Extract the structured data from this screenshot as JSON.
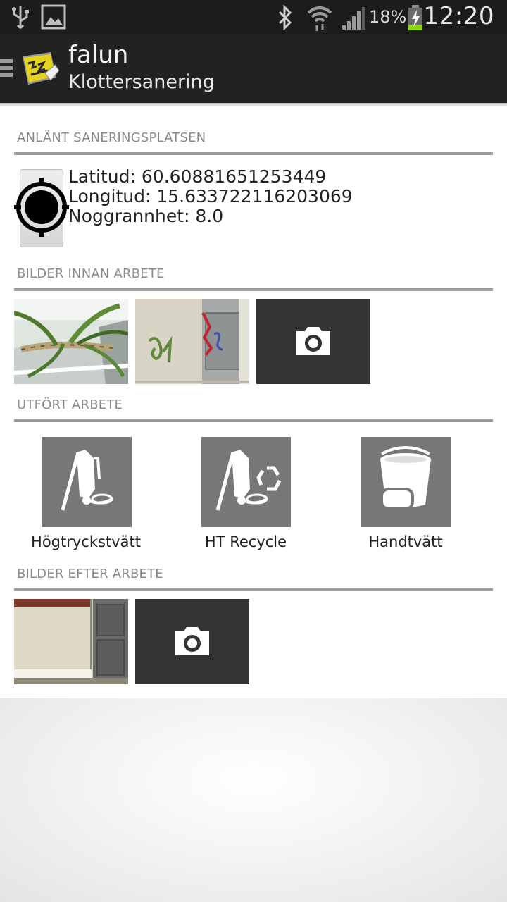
{
  "status_bar": {
    "time": "12:20",
    "battery_percent": "18%",
    "icons": [
      "usb-icon",
      "gallery-icon",
      "bluetooth-icon",
      "wifi-icon",
      "signal-icon",
      "battery-charging-icon"
    ]
  },
  "action_bar": {
    "title": "falun",
    "subtitle": "Klottersanering"
  },
  "sections": {
    "arrived": "ANLÄNT SANERINGSPLATSEN",
    "before": "BILDER INNAN ARBETE",
    "work": "UTFÖRT ARBETE",
    "after": "BILDER EFTER ARBETE"
  },
  "location": {
    "latitude": "Latitud: 60.60881651253449",
    "longitude": "Longitud: 15.633722116203069",
    "accuracy": "Noggrannhet: 8.0"
  },
  "work_options": [
    {
      "label": "Högtryckstvätt",
      "icon": "pressure-washer-icon"
    },
    {
      "label": "HT Recycle",
      "icon": "pressure-washer-recycle-icon"
    },
    {
      "label": "Handtvätt",
      "icon": "bucket-sponge-icon"
    }
  ],
  "colors": {
    "status_bar": "#1c1c1c",
    "action_bar": "#222222",
    "divider": "#9c9c9c",
    "camera_button": "#333333",
    "work_button": "#777777"
  }
}
